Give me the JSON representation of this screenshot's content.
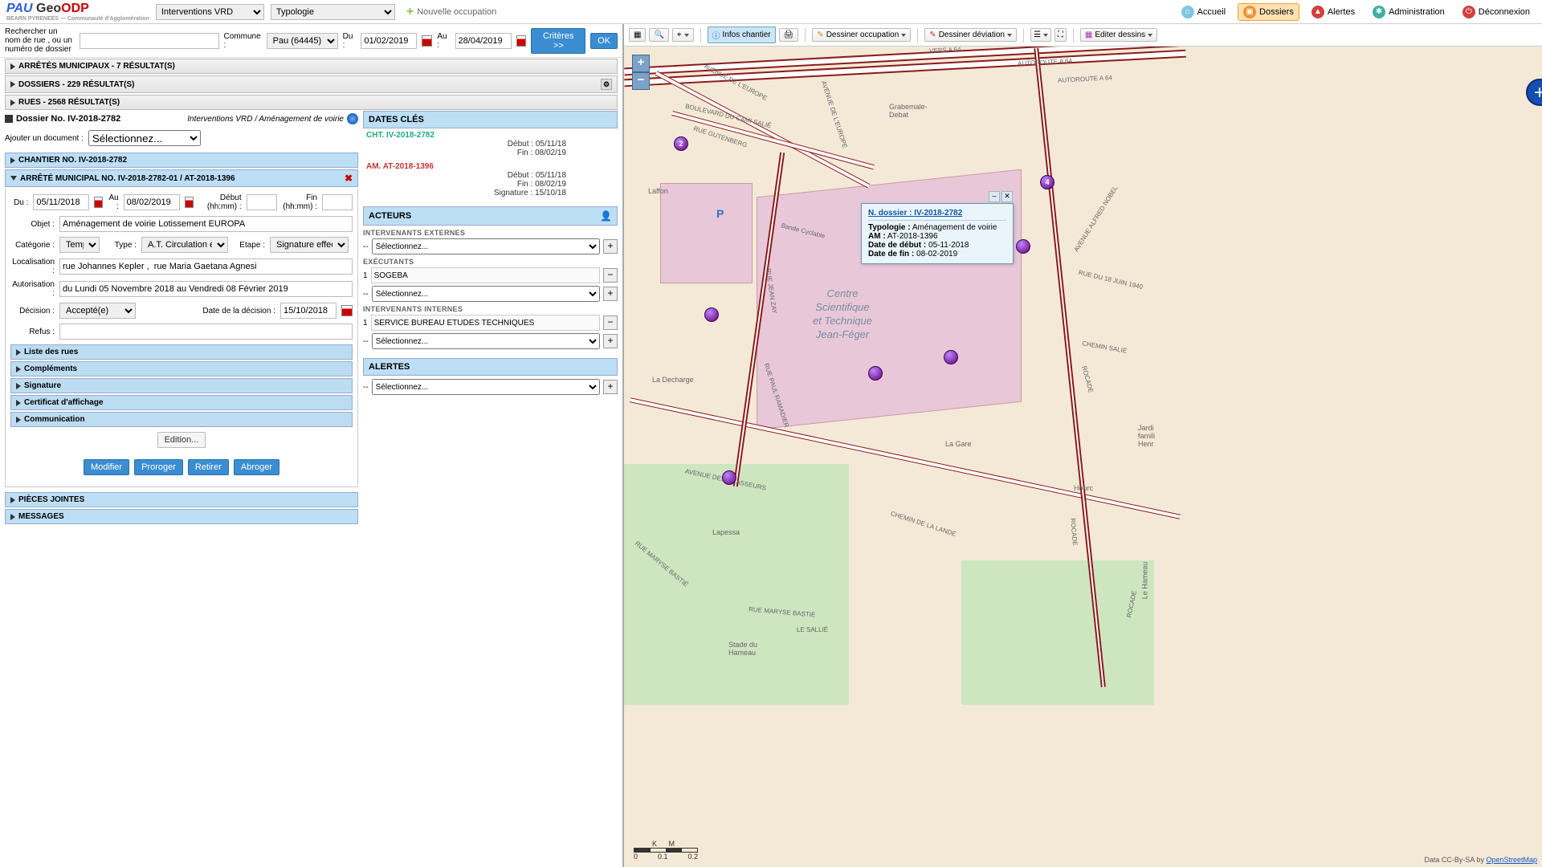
{
  "header": {
    "brand_sub": "BEARN PYRENEES — Communauté d'Agglomération",
    "select1": "Interventions VRD",
    "select2": "Typologie",
    "new_occ": "Nouvelle occupation",
    "nav": {
      "accueil": "Accueil",
      "dossiers": "Dossiers",
      "alertes": "Alertes",
      "admin": "Administration",
      "deco": "Déconnexion"
    }
  },
  "search": {
    "label": "Rechercher un nom de rue , ou un numéro de dossier",
    "commune_lbl": "Commune :",
    "commune_val": "Pau (64445)",
    "du_lbl": "Du :",
    "du_val": "01/02/2019",
    "au_lbl": "Au :",
    "au_val": "28/04/2019",
    "criteres": "Critères >>",
    "ok": "OK"
  },
  "accordions": {
    "arretes": "ARRÊTÉS MUNICIPAUX - 7 RÉSULTAT(S)",
    "dossiers": "DOSSIERS - 229 RÉSULTAT(S)",
    "rues": "RUES - 2568 RÉSULTAT(S)"
  },
  "dossier": {
    "title": "Dossier No. IV-2018-2782",
    "path": "Interventions VRD / Aménagement de voirie",
    "add_doc_lbl": "Ajouter un document :",
    "add_doc_ph": "Sélectionnez...",
    "chantier_hdr": "CHANTIER NO. IV-2018-2782",
    "arrete_hdr": "ARRÊTÉ MUNICIPAL NO. IV-2018-2782-01 / AT-2018-1396"
  },
  "form": {
    "du_lbl": "Du :",
    "du": "05/11/2018",
    "au_lbl": "Au :",
    "au": "08/02/2019",
    "debut_lbl": "Début (hh:mm) :",
    "fin_lbl": "Fin (hh:mm) :",
    "objet_lbl": "Objet :",
    "objet": "Aménagement de voirie Lotissement EUROPA",
    "cat_lbl": "Catégorie :",
    "cat": "Temporaire",
    "type_lbl": "Type :",
    "type": "A.T. Circulation et/ou",
    "etape_lbl": "Etape :",
    "etape": "Signature effective",
    "loc_lbl": "Localisation :",
    "loc": "rue Johannes Kepler ,  rue Maria Gaetana Agnesi",
    "auth_lbl": "Autorisation :",
    "auth": "du Lundi 05 Novembre 2018 au Vendredi 08 Février 2019",
    "dec_lbl": "Décision :",
    "dec": "Accepté(e)",
    "datedec_lbl": "Date de la décision :",
    "datedec": "15/10/2018",
    "refus_lbl": "Refus :",
    "sub": {
      "rues": "Liste des rues",
      "compl": "Compléments",
      "sig": "Signature",
      "cert": "Certificat d'affichage",
      "comm": "Communication"
    },
    "edition": "Edition...",
    "btns": {
      "modifier": "Modifier",
      "proroger": "Proroger",
      "retirer": "Retirer",
      "abroger": "Abroger"
    },
    "pj": "PIÈCES JOINTES",
    "msg": "MESSAGES"
  },
  "dates": {
    "hdr": "DATES CLÉS",
    "cht": {
      "title": "CHT. IV-2018-2782",
      "debut": "Début : 05/11/18",
      "fin": "Fin : 08/02/19"
    },
    "am": {
      "title": "AM. AT-2018-1396",
      "debut": "Début : 05/11/18",
      "fin": "Fin : 08/02/19",
      "sig": "Signature : 15/10/18"
    }
  },
  "acteurs": {
    "hdr": "ACTEURS",
    "ext_lbl": "INTERVENANTS EXTERNES",
    "exec_lbl": "EXÉCUTANTS",
    "exec1": "SOGEBA",
    "int_lbl": "INTERVENANTS INTERNES",
    "int1": "SERVICE BUREAU ETUDES TECHNIQUES",
    "alertes_hdr": "ALERTES",
    "select_ph": "Sélectionnez..."
  },
  "map": {
    "toolbar": {
      "infos": "Infos chantier",
      "occ": "Dessiner occupation",
      "dev": "Dessiner déviation",
      "edit": "Editer dessins"
    },
    "poi_center": "Centre\nScientifique\net Technique\nJean-Féger",
    "places": {
      "grab": "Grabemale-\nDebat",
      "laffon": "Laffon",
      "decharge": "La Decharge",
      "lapess": "Lapessa",
      "gare": "La Gare",
      "hourc": "Hourc",
      "jardins": "Jardi\nfamili\nHenr",
      "stade": "Stade du\nHameau",
      "hameau": "Le Hameau"
    },
    "streets": {
      "a64a": "VERS A 64",
      "a64b": "AUTOROUTE A 64",
      "a64c": "AUTOROUTE A 64",
      "europe": "AVENUE DE L'EUROPE",
      "europe2": "AVENUE DE L'EUROPE",
      "camisalie": "BOULEVARD DU CAMI SALIÉ",
      "gutenberg": "RUE GUTENBERG",
      "cyclable": "Bande Cyclable",
      "zay": "RUE JEAN ZAY",
      "ramadier": "RUE PAUL RAMADIER",
      "chasseurs": "AVENUE DES CHASSEURS",
      "lande": "CHEMIN DE LA LANDE",
      "salie": "CHEMIN SALIÉ",
      "juin": "RUE DU 18 JUIN 1940",
      "rocade": "ROCADE",
      "rocade2": "ROCADE",
      "rocade3": "ROCADE",
      "nobel": "AVENUE ALFRED NOBEL",
      "bastie": "RUE MARYSE BASTIÉ",
      "bastie2": "RUE MARYSE BASTIÉ",
      "sallie": "LE SALLIÉ"
    },
    "popup": {
      "link_lbl": "N. dossier :",
      "link_val": "IV-2018-2782",
      "typo_lbl": "Typologie :",
      "typo": "Aménagement de voirie",
      "am_lbl": "AM :",
      "am": "AT-2018-1396",
      "deb_lbl": "Date de début :",
      "deb": "05-11-2018",
      "fin_lbl": "Date de fin :",
      "fin": "08-02-2019"
    },
    "scale": {
      "a": "0",
      "b": "0.1",
      "c": "0.2",
      "unit": "K M"
    },
    "attrib": {
      "pre": "Data CC-By-SA by ",
      "link": "OpenStreetMap"
    }
  }
}
